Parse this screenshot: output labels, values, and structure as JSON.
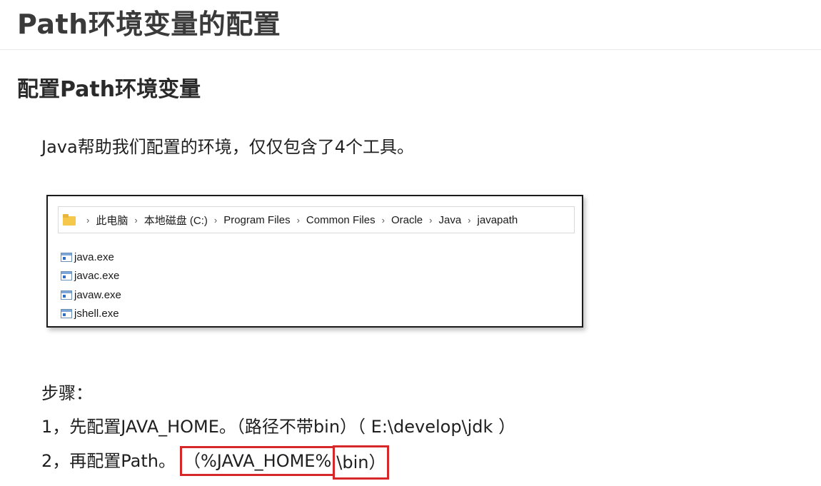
{
  "page": {
    "title": "Path环境变量的配置",
    "subtitle": "配置Path环境变量",
    "intro": "Java帮助我们配置的环境，仅仅包含了4个工具。"
  },
  "explorer": {
    "breadcrumb": [
      "此电脑",
      "本地磁盘 (C:)",
      "Program Files",
      "Common Files",
      "Oracle",
      "Java",
      "javapath"
    ],
    "separator": "›",
    "files": [
      "java.exe",
      "javac.exe",
      "javaw.exe",
      "jshell.exe"
    ]
  },
  "steps": {
    "heading": "步骤：",
    "step1": "1，先配置JAVA_HOME。（路径不带bin）（ E:\\develop\\jdk ）",
    "step2_prefix": "2，再配置Path。",
    "step2_highlight_a": "（%JAVA_HOME%",
    "step2_highlight_b": "\\bin）"
  },
  "colors": {
    "highlight_border": "#d62828",
    "folder": "#f5c84c"
  }
}
